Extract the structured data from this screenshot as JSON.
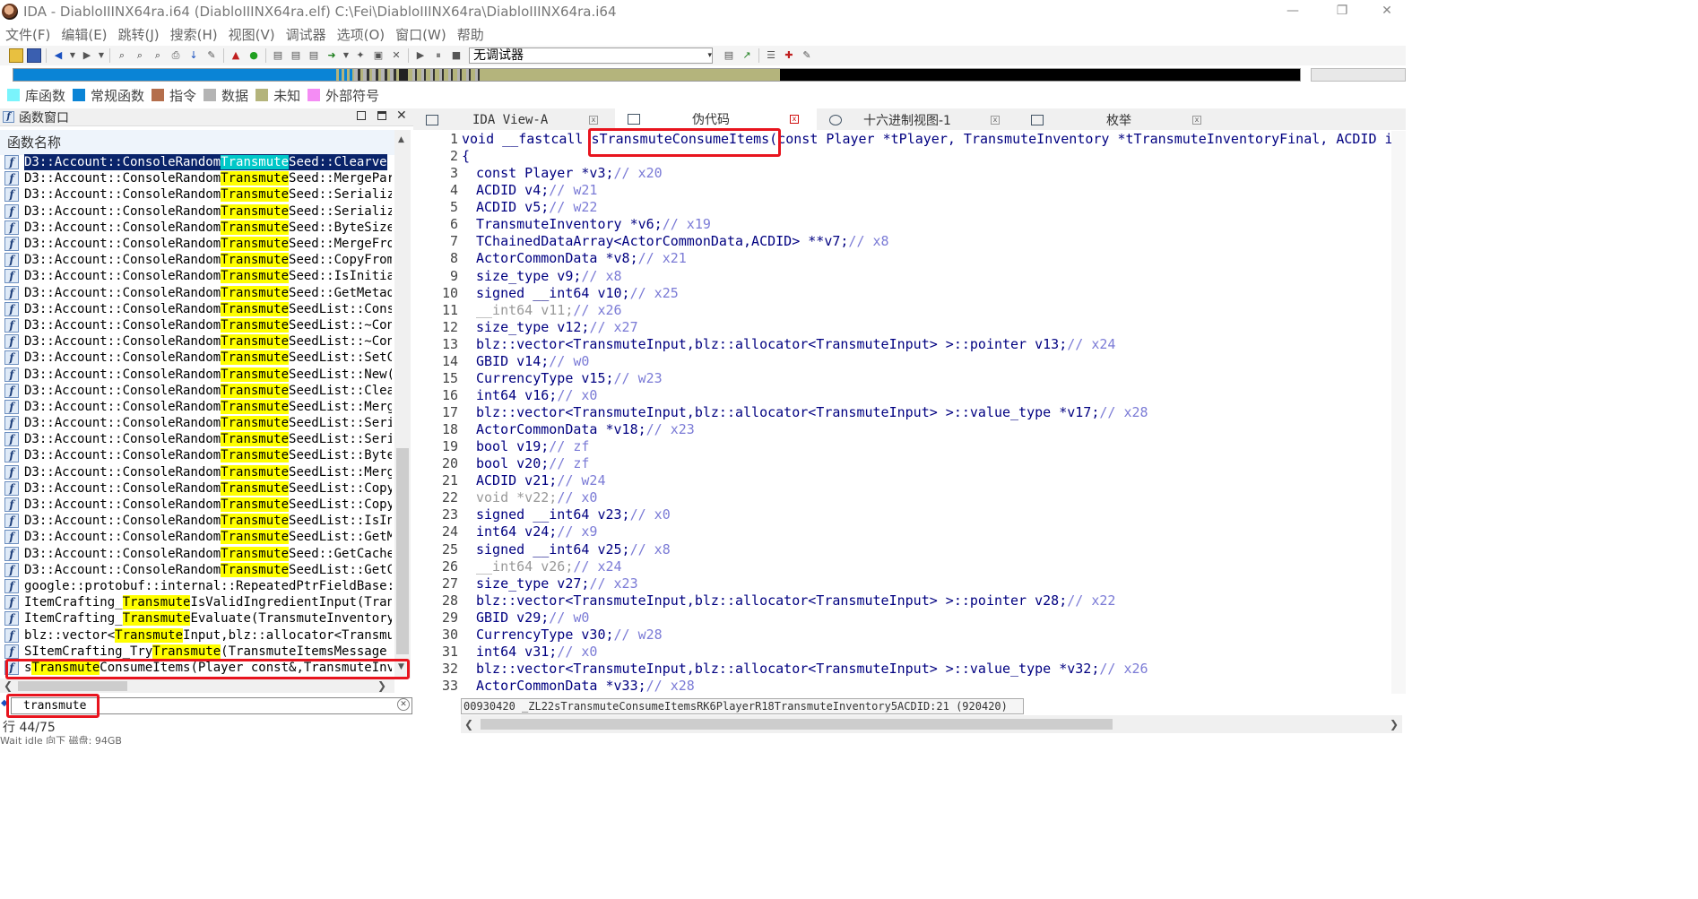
{
  "window": {
    "title": "IDA - DiabloIIINX64ra.i64 (DiabloIIINX64ra.elf) C:\\Fei\\DiabloIIINX64ra\\DiabloIIINX64ra.i64",
    "minimize": "—",
    "maximize": "❐",
    "close": "✕"
  },
  "menu": [
    "文件(F)",
    "编辑(E)",
    "跳转(J)",
    "搜索(H)",
    "视图(V)",
    "调试器",
    "选项(O)",
    "窗口(W)",
    "帮助"
  ],
  "toolbar": {
    "debugger_value": "无调试器",
    "debugger_arrow": "▾"
  },
  "legend": [
    {
      "label": "库函数",
      "color": "#7af4fc"
    },
    {
      "label": "常规函数",
      "color": "#0a84d6"
    },
    {
      "label": "指令",
      "color": "#b46e4c"
    },
    {
      "label": "数据",
      "color": "#b4b4b4"
    },
    {
      "label": "未知",
      "color": "#b4b47c"
    },
    {
      "label": "外部符号",
      "color": "#f48cf4"
    }
  ],
  "functions_window": {
    "title": "函数窗口",
    "column": "函数名称",
    "filter": "transmute",
    "line_count": "行 44/75",
    "status": "Wait  idle     向下     磁盘: 94GB",
    "icon_letter": "f",
    "rows": [
      {
        "pre": "D3::Account::ConsoleRandom",
        "hl": "Transmute",
        "post": "Seed::Clearve"
      },
      {
        "pre": "D3::Account::ConsoleRandom",
        "hl": "Transmute",
        "post": "Seed::MergePar"
      },
      {
        "pre": "D3::Account::ConsoleRandom",
        "hl": "Transmute",
        "post": "Seed::Serializ"
      },
      {
        "pre": "D3::Account::ConsoleRandom",
        "hl": "Transmute",
        "post": "Seed::Serializ"
      },
      {
        "pre": "D3::Account::ConsoleRandom",
        "hl": "Transmute",
        "post": "Seed::ByteSize"
      },
      {
        "pre": "D3::Account::ConsoleRandom",
        "hl": "Transmute",
        "post": "Seed::MergeFro"
      },
      {
        "pre": "D3::Account::ConsoleRandom",
        "hl": "Transmute",
        "post": "Seed::CopyFrom"
      },
      {
        "pre": "D3::Account::ConsoleRandom",
        "hl": "Transmute",
        "post": "Seed::IsInitia"
      },
      {
        "pre": "D3::Account::ConsoleRandom",
        "hl": "Transmute",
        "post": "Seed::GetMetad"
      },
      {
        "pre": "D3::Account::ConsoleRandom",
        "hl": "Transmute",
        "post": "SeedList::Cons"
      },
      {
        "pre": "D3::Account::ConsoleRandom",
        "hl": "Transmute",
        "post": "SeedList::~Con"
      },
      {
        "pre": "D3::Account::ConsoleRandom",
        "hl": "Transmute",
        "post": "SeedList::~Con"
      },
      {
        "pre": "D3::Account::ConsoleRandom",
        "hl": "Transmute",
        "post": "SeedList::SetC"
      },
      {
        "pre": "D3::Account::ConsoleRandom",
        "hl": "Transmute",
        "post": "SeedList::New("
      },
      {
        "pre": "D3::Account::ConsoleRandom",
        "hl": "Transmute",
        "post": "SeedList::Clea"
      },
      {
        "pre": "D3::Account::ConsoleRandom",
        "hl": "Transmute",
        "post": "SeedList::Merg"
      },
      {
        "pre": "D3::Account::ConsoleRandom",
        "hl": "Transmute",
        "post": "SeedList::Seri"
      },
      {
        "pre": "D3::Account::ConsoleRandom",
        "hl": "Transmute",
        "post": "SeedList::Seri"
      },
      {
        "pre": "D3::Account::ConsoleRandom",
        "hl": "Transmute",
        "post": "SeedList::Byte"
      },
      {
        "pre": "D3::Account::ConsoleRandom",
        "hl": "Transmute",
        "post": "SeedList::Merg"
      },
      {
        "pre": "D3::Account::ConsoleRandom",
        "hl": "Transmute",
        "post": "SeedList::Copy"
      },
      {
        "pre": "D3::Account::ConsoleRandom",
        "hl": "Transmute",
        "post": "SeedList::Copy"
      },
      {
        "pre": "D3::Account::ConsoleRandom",
        "hl": "Transmute",
        "post": "SeedList::IsIn"
      },
      {
        "pre": "D3::Account::ConsoleRandom",
        "hl": "Transmute",
        "post": "SeedList::GetM"
      },
      {
        "pre": "D3::Account::ConsoleRandom",
        "hl": "Transmute",
        "post": "Seed::GetCache"
      },
      {
        "pre": "D3::Account::ConsoleRandom",
        "hl": "Transmute",
        "post": "SeedList::GetC"
      },
      {
        "pre": "google::protobuf::internal::RepeatedPtrFieldBase:",
        "hl": "",
        "post": ""
      },
      {
        "pre": "ItemCrafting_",
        "hl": "Transmute",
        "post": "IsValidIngredientInput(Tran"
      },
      {
        "pre": "ItemCrafting_",
        "hl": "Transmute",
        "post": "Evaluate(TransmuteInventory"
      },
      {
        "pre": "blz::vector<",
        "hl": "Transmute",
        "post": "Input,blz::allocator<Transmu"
      },
      {
        "pre": "SItemCrafting_Try",
        "hl": "Transmute",
        "post": "(TransmuteItemsMessage"
      },
      {
        "pre": "s",
        "hl": "Transmute",
        "post": "ConsumeItems(Player const&,TransmuteInv"
      }
    ]
  },
  "tabs": [
    {
      "label": "IDA View-A"
    },
    {
      "label": "伪代码"
    },
    {
      "label": "十六进制视图-1"
    },
    {
      "label": "枚举"
    }
  ],
  "pseudocode": {
    "lines": [
      {
        "n": "1",
        "code": "void __fastcall sTransmuteConsumeItems(const Player *tPlayer, TransmuteInventory *tTransmuteInventoryFinal, ACDID id",
        "cm": ""
      },
      {
        "n": "2",
        "code": "{",
        "cm": ""
      },
      {
        "n": "3",
        "code": "const Player *v3; ",
        "cm": "// x20"
      },
      {
        "n": "4",
        "code": "ACDID v4; ",
        "cm": "// w21"
      },
      {
        "n": "5",
        "code": "ACDID v5; ",
        "cm": "// w22"
      },
      {
        "n": "6",
        "code": "TransmuteInventory *v6; ",
        "cm": "// x19"
      },
      {
        "n": "7",
        "code": "TChainedDataArray<ActorCommonData,ACDID> **v7; ",
        "cm": "// x8"
      },
      {
        "n": "8",
        "code": "ActorCommonData *v8; ",
        "cm": "// x21"
      },
      {
        "n": "9",
        "code": "size_type v9; ",
        "cm": "// x8"
      },
      {
        "n": "10",
        "code": "signed __int64 v10; ",
        "cm": "// x25"
      },
      {
        "n": "11",
        "code": "__int64 v11; ",
        "cm": "// x26"
      },
      {
        "n": "12",
        "code": "size_type v12; ",
        "cm": "// x27"
      },
      {
        "n": "13",
        "code": "blz::vector<TransmuteInput,blz::allocator<TransmuteInput> >::pointer v13; ",
        "cm": "// x24"
      },
      {
        "n": "14",
        "code": "GBID v14; ",
        "cm": "// w0"
      },
      {
        "n": "15",
        "code": "CurrencyType v15; ",
        "cm": "// w23"
      },
      {
        "n": "16",
        "code": "int64 v16; ",
        "cm": "// x0"
      },
      {
        "n": "17",
        "code": "blz::vector<TransmuteInput,blz::allocator<TransmuteInput> >::value_type *v17; ",
        "cm": "// x28"
      },
      {
        "n": "18",
        "code": "ActorCommonData *v18; ",
        "cm": "// x23"
      },
      {
        "n": "19",
        "code": "bool v19; ",
        "cm": "// zf"
      },
      {
        "n": "20",
        "code": "bool v20; ",
        "cm": "// zf"
      },
      {
        "n": "21",
        "code": "ACDID v21; ",
        "cm": "// w24"
      },
      {
        "n": "22",
        "code": "void *v22; ",
        "cm": "// x0"
      },
      {
        "n": "23",
        "code": "signed __int64 v23; ",
        "cm": "// x0"
      },
      {
        "n": "24",
        "code": "int64 v24; ",
        "cm": "// x9"
      },
      {
        "n": "25",
        "code": "signed __int64 v25; ",
        "cm": "// x8"
      },
      {
        "n": "26",
        "code": "__int64 v26; ",
        "cm": "// x24"
      },
      {
        "n": "27",
        "code": "size_type v27; ",
        "cm": "// x23"
      },
      {
        "n": "28",
        "code": "blz::vector<TransmuteInput,blz::allocator<TransmuteInput> >::pointer v28; ",
        "cm": "// x22"
      },
      {
        "n": "29",
        "code": "GBID v29; ",
        "cm": "// w0"
      },
      {
        "n": "30",
        "code": "CurrencyType v30; ",
        "cm": "// w28"
      },
      {
        "n": "31",
        "code": "int64 v31; ",
        "cm": "// x0"
      },
      {
        "n": "32",
        "code": "blz::vector<TransmuteInput,blz::allocator<TransmuteInput> >::value_type *v32; ",
        "cm": "// x26"
      },
      {
        "n": "33",
        "code": "ActorCommonData *v33; ",
        "cm": "// x28"
      }
    ],
    "status": "00930420 _ZL22sTransmuteConsumeItemsRK6PlayerR18TransmuteInventory5ACDID:21 (920420)"
  },
  "colors": {
    "highlight": "#ffff00",
    "selection": "#0a246a",
    "annotation": "#e8141e",
    "comment": "#7b7bd6",
    "code": "#000080"
  }
}
